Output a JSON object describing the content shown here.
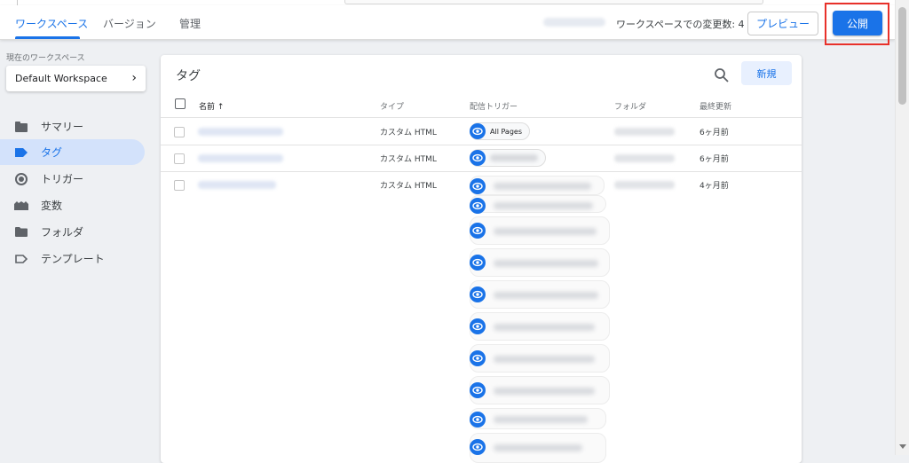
{
  "header": {
    "tabs": [
      {
        "label": "ワークスペース",
        "active": true
      },
      {
        "label": "バージョン",
        "active": false
      },
      {
        "label": "管理",
        "active": false
      }
    ],
    "changes_label": "ワークスペースでの変更数: 4",
    "preview_label": "プレビュー",
    "publish_label": "公開"
  },
  "workspace": {
    "caption": "現在のワークスペース",
    "name": "Default Workspace"
  },
  "sidebar": {
    "items": [
      {
        "label": "サマリー",
        "icon": "summary-icon",
        "active": false
      },
      {
        "label": "タグ",
        "icon": "tag-icon",
        "active": true
      },
      {
        "label": "トリガー",
        "icon": "trigger-icon",
        "active": false
      },
      {
        "label": "変数",
        "icon": "variables-icon",
        "active": false
      },
      {
        "label": "フォルダ",
        "icon": "folder-icon",
        "active": false
      },
      {
        "label": "テンプレート",
        "icon": "template-icon",
        "active": false
      }
    ]
  },
  "panel": {
    "title": "タグ",
    "new_label": "新規",
    "columns": {
      "name": "名前 ↑",
      "type": "タイプ",
      "trigger": "配信トリガー",
      "folder": "フォルダ",
      "updated": "最終更新"
    },
    "rows": [
      {
        "type": "カスタム HTML",
        "trigger": "All Pages",
        "updated": "6ヶ月前"
      },
      {
        "type": "カスタム HTML",
        "trigger": "",
        "updated": "6ヶ月前"
      },
      {
        "type": "カスタム HTML",
        "trigger": "",
        "updated": "4ヶ月前"
      }
    ]
  },
  "colors": {
    "accent": "#1a73e8",
    "highlight_box": "#e8312a",
    "active_nav_bg": "#d3e2fb"
  }
}
